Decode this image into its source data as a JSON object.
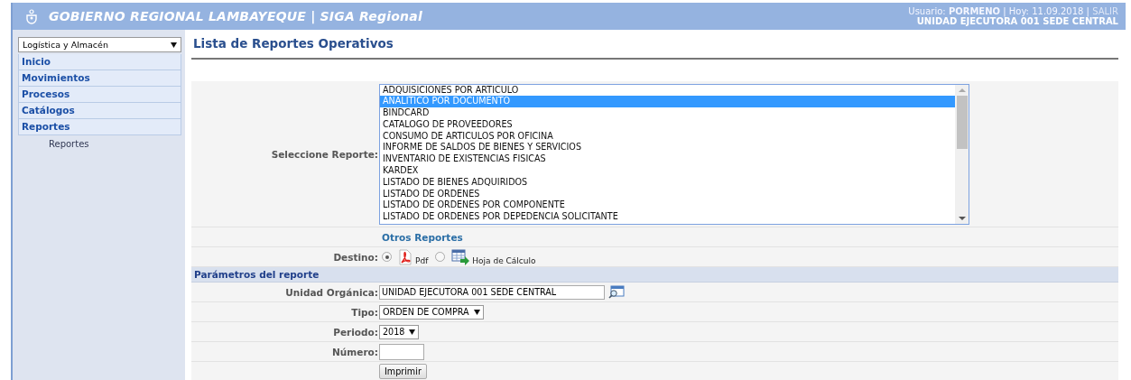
{
  "header": {
    "title": "GOBIERNO REGIONAL LAMBAYEQUE | SIGA Regional",
    "user_info": "Usuario: **PORMENO** | Hoy: 11.09.2018 |",
    "logout": "SALIR",
    "unit": "UNIDAD EJECUTORA 001 SEDE CENTRAL"
  },
  "sidebar": {
    "module": "Logística y Almacén",
    "items": [
      {
        "label": "Inicio"
      },
      {
        "label": "Movimientos"
      },
      {
        "label": "Procesos"
      },
      {
        "label": "Catálogos"
      },
      {
        "label": "Reportes",
        "children": [
          {
            "label": "Reportes"
          }
        ]
      }
    ]
  },
  "page_title": "Lista de Reportes Operativos",
  "report_select": {
    "label": "Seleccione Reporte:",
    "options": [
      {
        "label": "ADQUISICIONES POR ARTICULO",
        "selected": false
      },
      {
        "label": "ANALITICO POR DOCUMENTO",
        "selected": true
      },
      {
        "label": "BINDCARD",
        "selected": false
      },
      {
        "label": "CATALOGO DE PROVEEDORES",
        "selected": false
      },
      {
        "label": "CONSUMO DE ARTICULOS POR OFICINA",
        "selected": false
      },
      {
        "label": "INFORME DE SALDOS DE BIENES Y SERVICIOS",
        "selected": false
      },
      {
        "label": "INVENTARIO DE EXISTENCIAS FISICAS",
        "selected": false
      },
      {
        "label": "KARDEX",
        "selected": false
      },
      {
        "label": "LISTADO DE BIENES ADQUIRIDOS",
        "selected": false
      },
      {
        "label": "LISTADO DE ORDENES",
        "selected": false
      },
      {
        "label": "LISTADO DE ORDENES POR COMPONENTE",
        "selected": false
      },
      {
        "label": "LISTADO DE ORDENES POR DEPEDENCIA SOLICITANTE",
        "selected": false
      }
    ]
  },
  "other_reports": "Otros Reportes",
  "destination": {
    "label": "Destino:",
    "options": [
      {
        "kind": "pdf",
        "label": "Pdf",
        "selected": true
      },
      {
        "kind": "spreadsheet",
        "label": "Hoja de Cálculo",
        "selected": false
      }
    ]
  },
  "params": {
    "title": "Parámetros del reporte",
    "fields": [
      {
        "kind": "lookup",
        "label": "Unidad Orgánica:",
        "value": "UNIDAD EJECUTORA 001 SEDE CENTRAL"
      },
      {
        "kind": "select",
        "label": "Tipo:",
        "value": "ORDEN DE COMPRA"
      },
      {
        "kind": "select",
        "label": "Periodo:",
        "value": "2018"
      },
      {
        "kind": "text",
        "label": "Número:"
      }
    ]
  },
  "print_button": "Imprimir"
}
